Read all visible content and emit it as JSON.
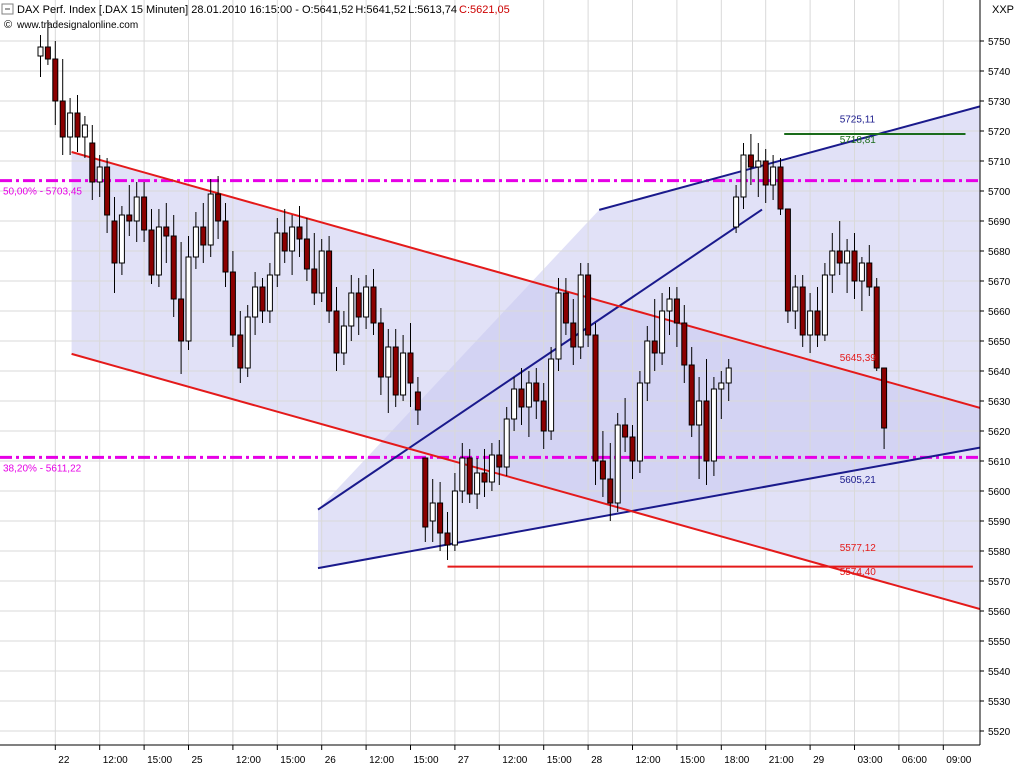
{
  "header": {
    "title_text": "DAX Perf. Index [.DAX  15 Minuten] 28.01.2010 16:15:00 - ",
    "open_text": "O:5641,52",
    "high_text": "H:5641,52",
    "low_text": "L:5613,74",
    "close_text": "C:5621,05",
    "source_text": "www.tradesignalonline.com",
    "symbol": "XXP",
    "close_color": "#cc0000"
  },
  "chart_data": {
    "type": "candlestick",
    "ylim": [
      5515,
      5757
    ],
    "y_ticks": [
      5750,
      5740,
      5730,
      5720,
      5710,
      5700,
      5690,
      5680,
      5670,
      5660,
      5650,
      5640,
      5630,
      5620,
      5610,
      5600,
      5590,
      5580,
      5570,
      5560,
      5550,
      5540,
      5530,
      5520
    ],
    "y_tick_labels": [
      "5750",
      "5740",
      "5730",
      "5720",
      "5710",
      "5700",
      "5690",
      "5680",
      "5670",
      "5660",
      "5650",
      "5640",
      "5630",
      "5620",
      "5610",
      "5600",
      "5590",
      "5580",
      "5570",
      "5560",
      "5550",
      "5540",
      "5530",
      "5520"
    ],
    "x_range": [
      0,
      152
    ],
    "x_ticks": [
      {
        "pos": 2,
        "label": "22"
      },
      {
        "pos": 8,
        "label": "12:00"
      },
      {
        "pos": 14,
        "label": "15:00"
      },
      {
        "pos": 20,
        "label": "25"
      },
      {
        "pos": 26,
        "label": "12:00"
      },
      {
        "pos": 32,
        "label": "15:00"
      },
      {
        "pos": 38,
        "label": "26"
      },
      {
        "pos": 44,
        "label": "12:00"
      },
      {
        "pos": 50,
        "label": "15:00"
      },
      {
        "pos": 56,
        "label": "27"
      },
      {
        "pos": 62,
        "label": "12:00"
      },
      {
        "pos": 68,
        "label": "15:00"
      },
      {
        "pos": 74,
        "label": "28"
      },
      {
        "pos": 80,
        "label": "12:00"
      },
      {
        "pos": 86,
        "label": "15:00"
      },
      {
        "pos": 92,
        "label": "18:00"
      },
      {
        "pos": 98,
        "label": "21:00"
      },
      {
        "pos": 104,
        "label": "29"
      },
      {
        "pos": 110,
        "label": "03:00"
      },
      {
        "pos": 116,
        "label": "06:00"
      },
      {
        "pos": 122,
        "label": "09:00"
      }
    ],
    "candles": [
      {
        "x": 0,
        "o": 5745,
        "h": 5752,
        "l": 5738,
        "c": 5748
      },
      {
        "x": 1,
        "o": 5748,
        "h": 5757,
        "l": 5742,
        "c": 5744
      },
      {
        "x": 2,
        "o": 5744,
        "h": 5750,
        "l": 5722,
        "c": 5730
      },
      {
        "x": 3,
        "o": 5730,
        "h": 5744,
        "l": 5712,
        "c": 5718
      },
      {
        "x": 4,
        "o": 5718,
        "h": 5731,
        "l": 5712,
        "c": 5726
      },
      {
        "x": 5,
        "o": 5726,
        "h": 5732,
        "l": 5713,
        "c": 5718
      },
      {
        "x": 6,
        "o": 5718,
        "h": 5725,
        "l": 5711,
        "c": 5722
      },
      {
        "x": 7,
        "o": 5716,
        "h": 5722,
        "l": 5697,
        "c": 5703
      },
      {
        "x": 8,
        "o": 5703,
        "h": 5712,
        "l": 5698,
        "c": 5708
      },
      {
        "x": 9,
        "o": 5708,
        "h": 5711,
        "l": 5686,
        "c": 5692
      },
      {
        "x": 10,
        "o": 5690,
        "h": 5698,
        "l": 5666,
        "c": 5676
      },
      {
        "x": 11,
        "o": 5676,
        "h": 5695,
        "l": 5672,
        "c": 5692
      },
      {
        "x": 12,
        "o": 5692,
        "h": 5702,
        "l": 5685,
        "c": 5690
      },
      {
        "x": 13,
        "o": 5690,
        "h": 5703,
        "l": 5683,
        "c": 5698
      },
      {
        "x": 14,
        "o": 5698,
        "h": 5703,
        "l": 5683,
        "c": 5687
      },
      {
        "x": 15,
        "o": 5687,
        "h": 5694,
        "l": 5669,
        "c": 5672
      },
      {
        "x": 16,
        "o": 5672,
        "h": 5694,
        "l": 5668,
        "c": 5688
      },
      {
        "x": 17,
        "o": 5688,
        "h": 5696,
        "l": 5676,
        "c": 5685
      },
      {
        "x": 18,
        "o": 5685,
        "h": 5692,
        "l": 5658,
        "c": 5664
      },
      {
        "x": 19,
        "o": 5664,
        "h": 5683,
        "l": 5639,
        "c": 5650
      },
      {
        "x": 20,
        "o": 5650,
        "h": 5685,
        "l": 5647,
        "c": 5678
      },
      {
        "x": 21,
        "o": 5678,
        "h": 5693,
        "l": 5674,
        "c": 5688
      },
      {
        "x": 22,
        "o": 5688,
        "h": 5696,
        "l": 5676,
        "c": 5682
      },
      {
        "x": 23,
        "o": 5682,
        "h": 5704,
        "l": 5678,
        "c": 5699
      },
      {
        "x": 24,
        "o": 5699,
        "h": 5705,
        "l": 5684,
        "c": 5690
      },
      {
        "x": 25,
        "o": 5690,
        "h": 5696,
        "l": 5668,
        "c": 5673
      },
      {
        "x": 26,
        "o": 5673,
        "h": 5680,
        "l": 5648,
        "c": 5652
      },
      {
        "x": 27,
        "o": 5652,
        "h": 5660,
        "l": 5636,
        "c": 5641
      },
      {
        "x": 28,
        "o": 5641,
        "h": 5662,
        "l": 5638,
        "c": 5658
      },
      {
        "x": 29,
        "o": 5658,
        "h": 5673,
        "l": 5652,
        "c": 5668
      },
      {
        "x": 30,
        "o": 5668,
        "h": 5671,
        "l": 5656,
        "c": 5660
      },
      {
        "x": 31,
        "o": 5660,
        "h": 5676,
        "l": 5656,
        "c": 5672
      },
      {
        "x": 32,
        "o": 5672,
        "h": 5691,
        "l": 5668,
        "c": 5686
      },
      {
        "x": 33,
        "o": 5686,
        "h": 5694,
        "l": 5676,
        "c": 5680
      },
      {
        "x": 34,
        "o": 5680,
        "h": 5692,
        "l": 5672,
        "c": 5688
      },
      {
        "x": 35,
        "o": 5688,
        "h": 5695,
        "l": 5678,
        "c": 5684
      },
      {
        "x": 36,
        "o": 5684,
        "h": 5691,
        "l": 5670,
        "c": 5674
      },
      {
        "x": 37,
        "o": 5674,
        "h": 5686,
        "l": 5662,
        "c": 5666
      },
      {
        "x": 38,
        "o": 5666,
        "h": 5684,
        "l": 5663,
        "c": 5680
      },
      {
        "x": 39,
        "o": 5680,
        "h": 5685,
        "l": 5656,
        "c": 5660
      },
      {
        "x": 40,
        "o": 5660,
        "h": 5668,
        "l": 5640,
        "c": 5646
      },
      {
        "x": 41,
        "o": 5646,
        "h": 5660,
        "l": 5642,
        "c": 5655
      },
      {
        "x": 42,
        "o": 5655,
        "h": 5672,
        "l": 5650,
        "c": 5666
      },
      {
        "x": 43,
        "o": 5666,
        "h": 5671,
        "l": 5652,
        "c": 5658
      },
      {
        "x": 44,
        "o": 5658,
        "h": 5672,
        "l": 5654,
        "c": 5668
      },
      {
        "x": 45,
        "o": 5668,
        "h": 5674,
        "l": 5652,
        "c": 5656
      },
      {
        "x": 46,
        "o": 5656,
        "h": 5661,
        "l": 5632,
        "c": 5638
      },
      {
        "x": 47,
        "o": 5638,
        "h": 5654,
        "l": 5626,
        "c": 5648
      },
      {
        "x": 48,
        "o": 5648,
        "h": 5654,
        "l": 5628,
        "c": 5632
      },
      {
        "x": 49,
        "o": 5632,
        "h": 5652,
        "l": 5630,
        "c": 5646
      },
      {
        "x": 50,
        "o": 5646,
        "h": 5656,
        "l": 5628,
        "c": 5636
      },
      {
        "x": 51,
        "o": 5633,
        "h": 5638,
        "l": 5622,
        "c": 5627
      },
      {
        "x": 52,
        "o": 5611,
        "h": 5609,
        "l": 5583,
        "c": 5588
      },
      {
        "x": 53,
        "o": 5590,
        "h": 5604,
        "l": 5583,
        "c": 5596
      },
      {
        "x": 54,
        "o": 5596,
        "h": 5603,
        "l": 5580,
        "c": 5586
      },
      {
        "x": 55,
        "o": 5586,
        "h": 5593,
        "l": 5577,
        "c": 5582
      },
      {
        "x": 56,
        "o": 5582,
        "h": 5606,
        "l": 5580,
        "c": 5600
      },
      {
        "x": 57,
        "o": 5600,
        "h": 5616,
        "l": 5596,
        "c": 5611
      },
      {
        "x": 58,
        "o": 5611,
        "h": 5614,
        "l": 5596,
        "c": 5599
      },
      {
        "x": 59,
        "o": 5599,
        "h": 5611,
        "l": 5594,
        "c": 5606
      },
      {
        "x": 60,
        "o": 5606,
        "h": 5614,
        "l": 5598,
        "c": 5603
      },
      {
        "x": 61,
        "o": 5603,
        "h": 5616,
        "l": 5600,
        "c": 5612
      },
      {
        "x": 62,
        "o": 5612,
        "h": 5617,
        "l": 5602,
        "c": 5608
      },
      {
        "x": 63,
        "o": 5608,
        "h": 5628,
        "l": 5605,
        "c": 5624
      },
      {
        "x": 64,
        "o": 5624,
        "h": 5638,
        "l": 5620,
        "c": 5634
      },
      {
        "x": 65,
        "o": 5634,
        "h": 5641,
        "l": 5622,
        "c": 5628
      },
      {
        "x": 66,
        "o": 5628,
        "h": 5640,
        "l": 5618,
        "c": 5636
      },
      {
        "x": 67,
        "o": 5636,
        "h": 5641,
        "l": 5624,
        "c": 5630
      },
      {
        "x": 68,
        "o": 5630,
        "h": 5636,
        "l": 5614,
        "c": 5620
      },
      {
        "x": 69,
        "o": 5620,
        "h": 5648,
        "l": 5617,
        "c": 5644
      },
      {
        "x": 70,
        "o": 5644,
        "h": 5671,
        "l": 5640,
        "c": 5666
      },
      {
        "x": 71,
        "o": 5666,
        "h": 5671,
        "l": 5652,
        "c": 5656
      },
      {
        "x": 72,
        "o": 5656,
        "h": 5664,
        "l": 5642,
        "c": 5648
      },
      {
        "x": 73,
        "o": 5648,
        "h": 5676,
        "l": 5644,
        "c": 5672
      },
      {
        "x": 74,
        "o": 5672,
        "h": 5676,
        "l": 5648,
        "c": 5652
      },
      {
        "x": 75,
        "o": 5652,
        "h": 5656,
        "l": 5602,
        "c": 5610
      },
      {
        "x": 76,
        "o": 5610,
        "h": 5620,
        "l": 5598,
        "c": 5604
      },
      {
        "x": 77,
        "o": 5604,
        "h": 5616,
        "l": 5590,
        "c": 5596
      },
      {
        "x": 78,
        "o": 5596,
        "h": 5626,
        "l": 5593,
        "c": 5622
      },
      {
        "x": 79,
        "o": 5622,
        "h": 5631,
        "l": 5613,
        "c": 5618
      },
      {
        "x": 80,
        "o": 5618,
        "h": 5622,
        "l": 5604,
        "c": 5610
      },
      {
        "x": 81,
        "o": 5610,
        "h": 5640,
        "l": 5606,
        "c": 5636
      },
      {
        "x": 82,
        "o": 5636,
        "h": 5655,
        "l": 5630,
        "c": 5650
      },
      {
        "x": 83,
        "o": 5650,
        "h": 5664,
        "l": 5640,
        "c": 5646
      },
      {
        "x": 84,
        "o": 5646,
        "h": 5666,
        "l": 5642,
        "c": 5660
      },
      {
        "x": 85,
        "o": 5660,
        "h": 5668,
        "l": 5652,
        "c": 5664
      },
      {
        "x": 86,
        "o": 5664,
        "h": 5668,
        "l": 5648,
        "c": 5656
      },
      {
        "x": 87,
        "o": 5656,
        "h": 5662,
        "l": 5636,
        "c": 5642
      },
      {
        "x": 88,
        "o": 5642,
        "h": 5648,
        "l": 5618,
        "c": 5622
      },
      {
        "x": 89,
        "o": 5622,
        "h": 5638,
        "l": 5604,
        "c": 5630
      },
      {
        "x": 90,
        "o": 5630,
        "h": 5644,
        "l": 5602,
        "c": 5610
      },
      {
        "x": 91,
        "o": 5610,
        "h": 5638,
        "l": 5605,
        "c": 5634
      },
      {
        "x": 92,
        "o": 5634,
        "h": 5640,
        "l": 5624,
        "c": 5636
      },
      {
        "x": 93,
        "o": 5636,
        "h": 5644,
        "l": 5630,
        "c": 5641
      },
      {
        "x": 94,
        "o": 5688,
        "h": 5702,
        "l": 5686,
        "c": 5698
      },
      {
        "x": 95,
        "o": 5698,
        "h": 5716,
        "l": 5694,
        "c": 5712
      },
      {
        "x": 96,
        "o": 5712,
        "h": 5719,
        "l": 5702,
        "c": 5708
      },
      {
        "x": 97,
        "o": 5708,
        "h": 5716,
        "l": 5698,
        "c": 5710
      },
      {
        "x": 98,
        "o": 5710,
        "h": 5714,
        "l": 5696,
        "c": 5702
      },
      {
        "x": 99,
        "o": 5702,
        "h": 5712,
        "l": 5697,
        "c": 5708
      },
      {
        "x": 100,
        "o": 5708,
        "h": 5711,
        "l": 5692,
        "c": 5694
      },
      {
        "x": 101,
        "o": 5694,
        "h": 5692,
        "l": 5656,
        "c": 5660
      },
      {
        "x": 102,
        "o": 5660,
        "h": 5672,
        "l": 5654,
        "c": 5668
      },
      {
        "x": 103,
        "o": 5668,
        "h": 5672,
        "l": 5648,
        "c": 5652
      },
      {
        "x": 104,
        "o": 5652,
        "h": 5666,
        "l": 5646,
        "c": 5660
      },
      {
        "x": 105,
        "o": 5660,
        "h": 5668,
        "l": 5648,
        "c": 5652
      },
      {
        "x": 106,
        "o": 5652,
        "h": 5676,
        "l": 5650,
        "c": 5672
      },
      {
        "x": 107,
        "o": 5672,
        "h": 5686,
        "l": 5666,
        "c": 5680
      },
      {
        "x": 108,
        "o": 5680,
        "h": 5690,
        "l": 5672,
        "c": 5676
      },
      {
        "x": 109,
        "o": 5676,
        "h": 5684,
        "l": 5666,
        "c": 5680
      },
      {
        "x": 110,
        "o": 5680,
        "h": 5686,
        "l": 5664,
        "c": 5670
      },
      {
        "x": 111,
        "o": 5670,
        "h": 5678,
        "l": 5660,
        "c": 5676
      },
      {
        "x": 112,
        "o": 5676,
        "h": 5682,
        "l": 5665,
        "c": 5668
      },
      {
        "x": 113,
        "o": 5668,
        "h": 5671,
        "l": 5640,
        "c": 5641
      },
      {
        "x": 114,
        "o": 5641,
        "h": 5641,
        "l": 5614,
        "c": 5621
      }
    ],
    "series": [
      {
        "name": "5605,21",
        "kind": "line",
        "color": "#1a1a8c",
        "points": [
          [
            37.5,
            5593.8
          ],
          [
            97.5,
            5693.8
          ]
        ]
      },
      {
        "name": "5605,21",
        "kind": "line",
        "color": "#1a1a8c",
        "points": [
          [
            37.5,
            5574.3
          ],
          [
            152,
            5625.7
          ]
        ]
      },
      {
        "name": "5645,39",
        "kind": "line",
        "color": "#e41a1a",
        "points": [
          [
            4.2,
            5713
          ],
          [
            152,
            5610.3
          ]
        ]
      },
      {
        "name": "5577,12",
        "kind": "line",
        "color": "#e41a1a",
        "points": [
          [
            4.2,
            5645.7
          ],
          [
            152,
            5543.3
          ]
        ]
      },
      {
        "name": "5725,11",
        "kind": "line",
        "color": "#1a1a8c",
        "points": [
          [
            75.5,
            5693.7
          ],
          [
            152,
            5745
          ]
        ]
      },
      {
        "name": "5718,81",
        "kind": "line",
        "color": "#1a6b1a",
        "points": [
          [
            100.5,
            5719
          ],
          [
            125,
            5719
          ]
        ]
      },
      {
        "name": "5574,40",
        "kind": "line",
        "color": "#e41a1a",
        "points": [
          [
            55,
            5574.8
          ],
          [
            126,
            5574.8
          ]
        ]
      }
    ],
    "levels": [
      {
        "label": "50,00% - 5703,45",
        "value": 5703.45,
        "color": "#e600e6"
      },
      {
        "label": "38,20% - 5611,22",
        "value": 5611.22,
        "color": "#e600e6"
      }
    ],
    "annotations": [
      {
        "text": "5725,11",
        "x": 108,
        "y": 5722.8,
        "color": "#1a1a8c"
      },
      {
        "text": "5718,81",
        "x": 108,
        "y": 5716.0,
        "color": "#1a6b1a"
      },
      {
        "text": "5645,39",
        "x": 108,
        "y": 5643.3,
        "color": "#e41a1a"
      },
      {
        "text": "5605,21",
        "x": 108,
        "y": 5602.7,
        "color": "#1a1a8c"
      },
      {
        "text": "5577,12",
        "x": 108,
        "y": 5580.0,
        "color": "#e41a1a"
      },
      {
        "text": "5574,40",
        "x": 108,
        "y": 5572.0,
        "color": "#e41a1a"
      }
    ],
    "colors": {
      "up": "#ffffff",
      "down": "#8b0000",
      "wick": "#000000",
      "fib": "#e600e6",
      "channel_fill": "#c8c8f0"
    }
  }
}
